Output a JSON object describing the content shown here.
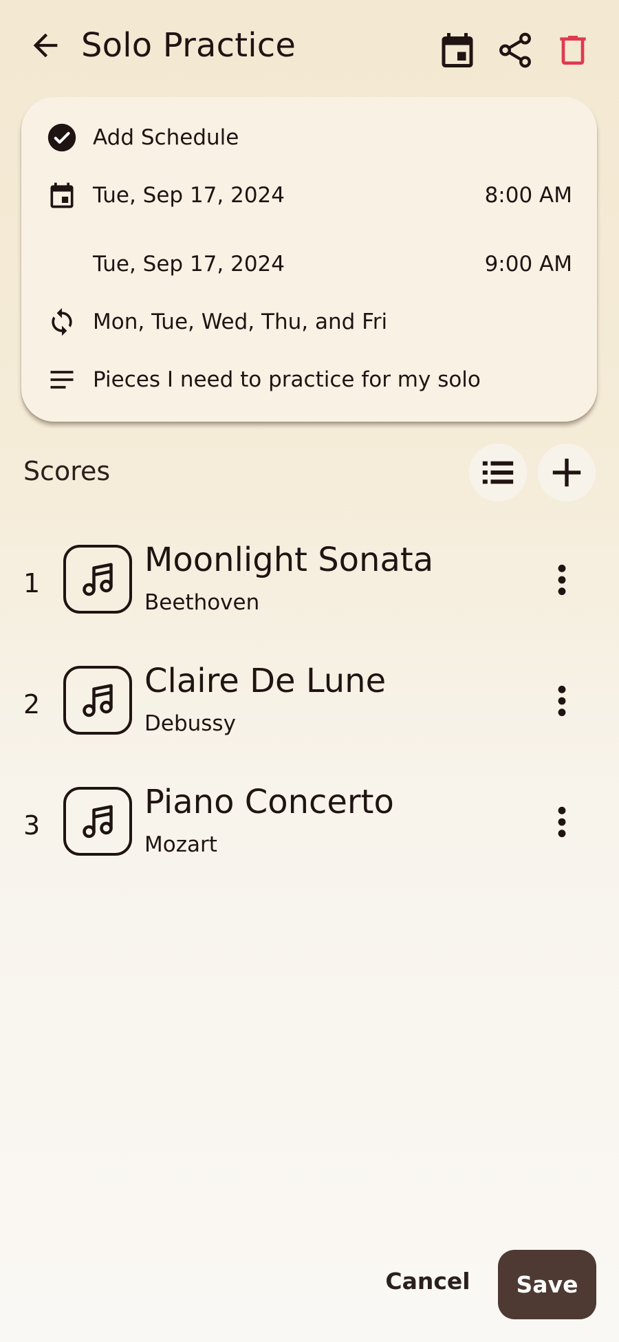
{
  "header": {
    "title": "Solo Practice",
    "icons": {
      "back": "arrow-left-icon",
      "calendar": "calendar-icon",
      "share": "share-icon",
      "delete": "trash-icon"
    },
    "delete_color": "#e0394f"
  },
  "schedule": {
    "add_schedule_label": "Add Schedule",
    "start_date": "Tue, Sep 17, 2024",
    "start_time": "8:00 AM",
    "end_date": "Tue, Sep 17, 2024",
    "end_time": "9:00 AM",
    "repeat": "Mon, Tue, Wed, Thu, and Fri",
    "notes": "Pieces I need to practice for my solo"
  },
  "scores": {
    "section_label": "Scores",
    "items": [
      {
        "number": "1",
        "title": "Moonlight Sonata",
        "composer": "Beethoven"
      },
      {
        "number": "2",
        "title": "Claire De Lune",
        "composer": "Debussy"
      },
      {
        "number": "3",
        "title": "Piano Concerto",
        "composer": "Mozart"
      }
    ]
  },
  "actions": {
    "cancel": "Cancel",
    "save": "Save"
  },
  "colors": {
    "accent": "#4e3a33",
    "text": "#1f1412",
    "delete": "#e0394f"
  }
}
